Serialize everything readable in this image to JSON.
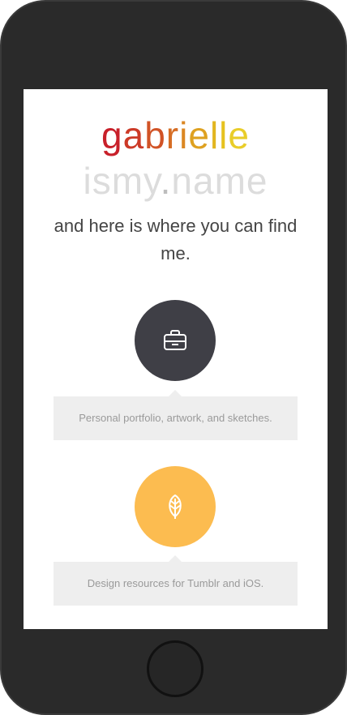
{
  "header": {
    "name": [
      "g",
      "a",
      "b",
      "r",
      "i",
      "e",
      "l",
      "l",
      "e"
    ],
    "name_colors": [
      "#c8202a",
      "#cc3a27",
      "#d15326",
      "#d66d24",
      "#db8723",
      "#dea121",
      "#e2b620",
      "#e6c21f",
      "#e9cd2a"
    ],
    "domain_part1": "ismy",
    "domain_dot": ".",
    "domain_part2": "name",
    "tagline": "and here is where you can find me."
  },
  "links": [
    {
      "icon": "briefcase-icon",
      "color": "#3f3f46",
      "text": "Personal portfolio, artwork, and sketches."
    },
    {
      "icon": "leaf-icon",
      "color": "#fcbc50",
      "text": "Design resources for Tumblr and iOS."
    }
  ]
}
